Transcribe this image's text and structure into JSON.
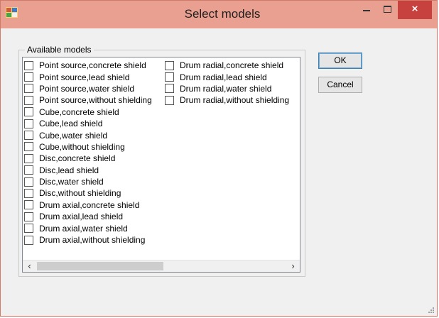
{
  "window": {
    "title": "Select models"
  },
  "group": {
    "label": "Available models",
    "column1": [
      "Point source,concrete shield",
      "Point source,lead shield",
      "Point source,water shield",
      "Point source,without shielding",
      "Cube,concrete shield",
      "Cube,lead shield",
      "Cube,water shield",
      "Cube,without shielding",
      "Disc,concrete shield",
      "Disc,lead shield",
      "Disc,water shield",
      "Disc,without shielding",
      "Drum axial,concrete shield",
      "Drum axial,lead shield",
      "Drum axial,water shield",
      "Drum axial,without shielding"
    ],
    "column2": [
      "Drum radial,concrete shield",
      "Drum radial,lead shield",
      "Drum radial,water shield",
      "Drum radial,without shielding"
    ]
  },
  "buttons": {
    "ok": "OK",
    "cancel": "Cancel"
  },
  "icons": {
    "close": "×",
    "left": "‹",
    "right": "›"
  },
  "colors": {
    "titlebar": "#e9a091",
    "close_button": "#c7413e"
  }
}
